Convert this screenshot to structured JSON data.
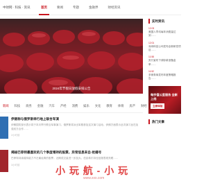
{
  "header": {
    "brand": "中财网 · 科技 · 资讯",
    "nav": [
      {
        "label": "首页",
        "active": true
      },
      {
        "label": "要闻",
        "active": false
      },
      {
        "label": "专题",
        "active": false
      },
      {
        "label": "金融界",
        "active": false
      },
      {
        "label": "财经资讯",
        "active": false
      }
    ]
  },
  "hero": {
    "caption": "2024年节假日放假安排公告"
  },
  "categories": [
    "新闻",
    "科技",
    "商务",
    "金融",
    "汽车",
    "产经",
    "消费",
    "娱乐",
    "文化",
    "教育",
    "体育",
    "房产",
    "财经"
  ],
  "categories_active": 0,
  "articles": [
    {
      "title": "伊朗称与俄罗斯举行地上联合军演",
      "summary": "伊朗国防部长表示将于本月举行联合军事演习，俄罗斯将派出军舰参加这次演习活动，伊朗方面表示此次演习旨在加强双方合作……",
      "meta": "2小时前"
    },
    {
      "title": "揭秘巴菲特最喜欢的几个季度增持的股票，异常信息来自·抢播号",
      "summary": "巴菲特持续增持能力不乏最经典的股票，近期成交量进一步加大。伯克希尔持仓回报表现亮眼……",
      "meta": "3小时前"
    }
  ],
  "sidebar": {
    "heading": "实时资讯",
    "items": [
      {
        "time": "12:03",
        "text": "美国人早均每年消费量达到……"
      },
      {
        "time": "12:01",
        "text": "深圳科技公司发布全新研发项目……"
      },
      {
        "time": "11:58",
        "text": "央行宣布下调存款准备金率……"
      },
      {
        "time": "11:52",
        "text": "多家券商发布年度策略报告……"
      }
    ],
    "ad_title": "每抄值公里服务 全新上线",
    "ad_button": "立即体验",
    "section2": "热门文章"
  },
  "watermark": {
    "text": "小 玩 航 - 小 玩",
    "url": "www.xxx.com"
  },
  "colors": {
    "accent": "#c9151e"
  }
}
